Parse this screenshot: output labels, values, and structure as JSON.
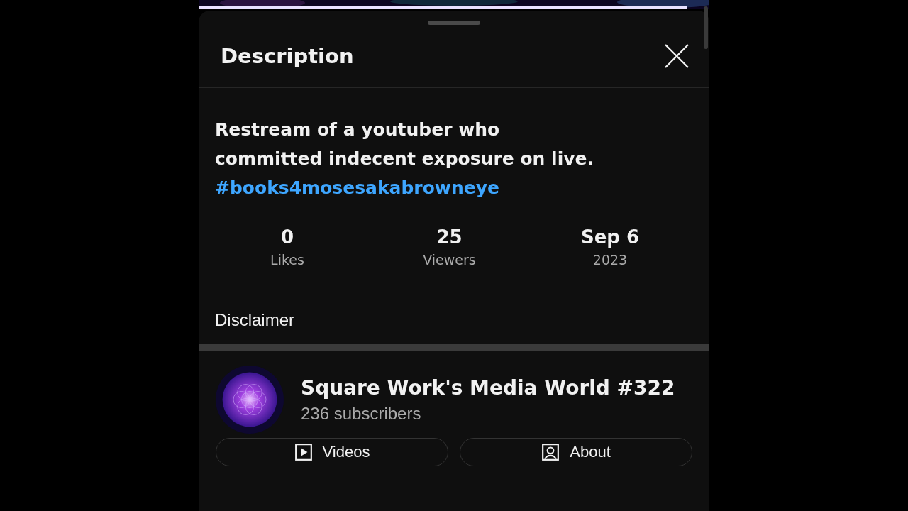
{
  "panel": {
    "title": "Description"
  },
  "description": {
    "lines": [
      "Restream of a youtuber who",
      "committed indecent exposure on live."
    ],
    "hashtag": "#books4mosesakabrowneye"
  },
  "stats": [
    {
      "value": "0",
      "label": "Likes"
    },
    {
      "value": "25",
      "label": "Viewers"
    },
    {
      "value": "Sep 6",
      "label": "2023"
    }
  ],
  "disclaimer": "Disclaimer",
  "channel": {
    "name": "Square Work's Media World #322",
    "subscribers": "236 subscribers"
  },
  "buttons": [
    {
      "kind": "videos",
      "label": "Videos"
    },
    {
      "kind": "about",
      "label": "About"
    }
  ]
}
